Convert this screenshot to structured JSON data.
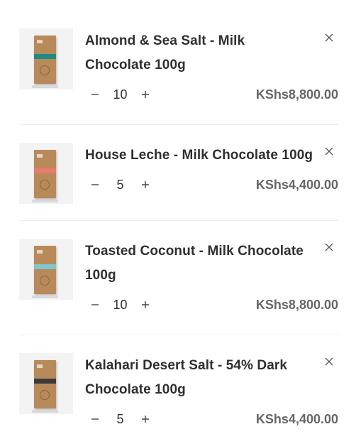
{
  "cart": {
    "items": [
      {
        "title": "Almond & Sea Salt - Milk Chocolate 100g",
        "quantity": "10",
        "price": "KShs8,800.00",
        "band_color": "#1e8c86"
      },
      {
        "title": "House Leche - Milk Chocolate 100g",
        "quantity": "5",
        "price": "KShs4,400.00",
        "band_color": "#e87a6e"
      },
      {
        "title": "Toasted Coconut - Milk Chocolate 100g",
        "quantity": "10",
        "price": "KShs8,800.00",
        "band_color": "#7fc6cf"
      },
      {
        "title": "Kalahari Desert Salt - 54% Dark Chocolate 100g",
        "quantity": "5",
        "price": "KShs4,400.00",
        "band_color": "#3b3b3b"
      }
    ]
  },
  "icons": {
    "remove": "close-icon",
    "decrease": "minus-icon",
    "increase": "plus-icon"
  }
}
